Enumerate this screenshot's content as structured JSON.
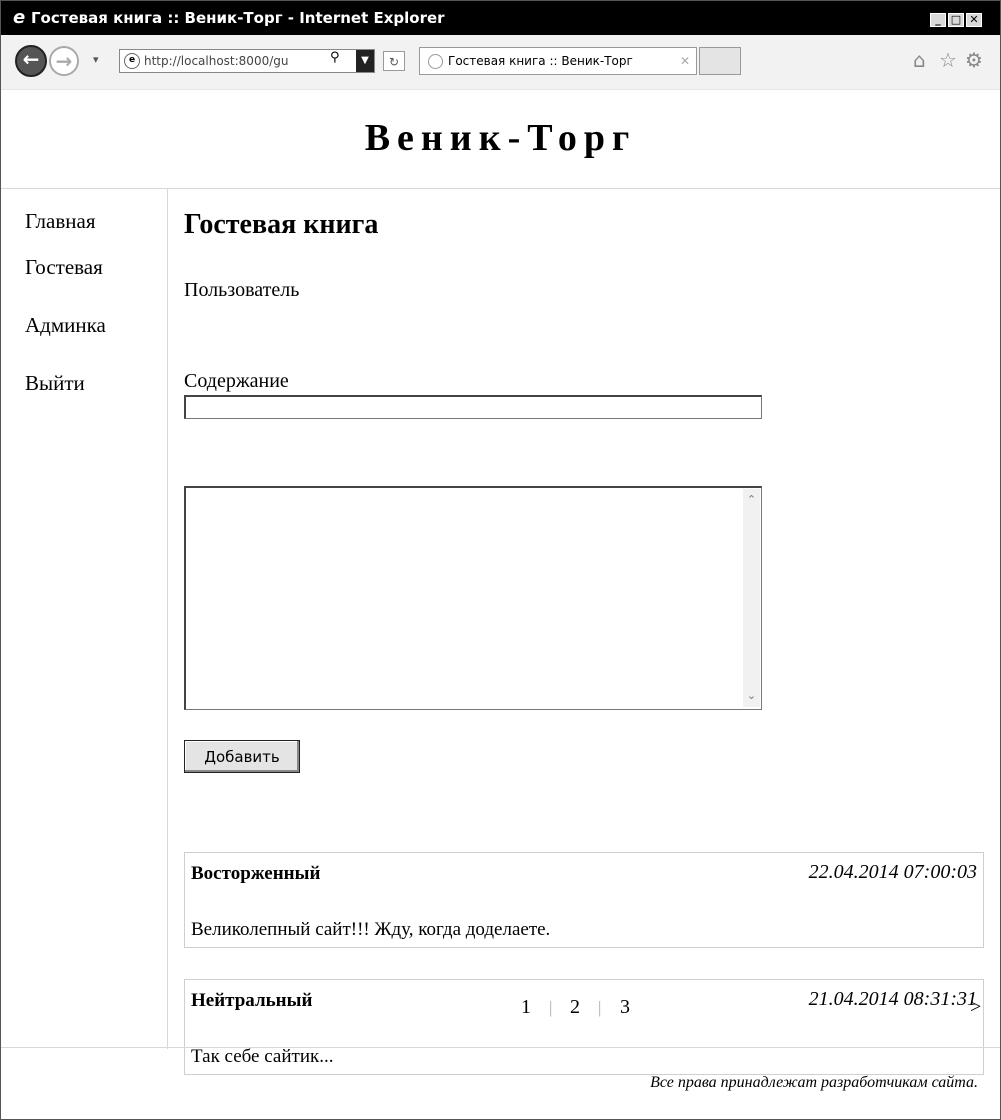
{
  "window": {
    "title": "Гостевая книга :: Веник-Торг - Internet Explorer",
    "controls": [
      "_",
      "□",
      "✕"
    ]
  },
  "browser": {
    "address": "http://localhost:8000/gu",
    "tab_title": "Гостевая книга :: Веник-Торг",
    "icons": [
      "back-icon",
      "forward-icon",
      "ie-page-icon",
      "search-icon",
      "refresh-icon",
      "home-icon",
      "favorites-star-icon",
      "settings-gear-icon"
    ]
  },
  "site": {
    "title": "Веник-Торг",
    "nav": [
      "Главная",
      "Гостевая",
      "Админка",
      "Выйти"
    ]
  },
  "form": {
    "heading": "Гостевая книга",
    "user_label": "Пользователь",
    "user_value": "",
    "content_label": "Содержание",
    "content_value": "",
    "submit_label": "Добавить"
  },
  "entries": [
    {
      "author": "Восторженный",
      "date": "22.04.2014 07:00:03",
      "text": "Великолепный сайт!!! Жду, когда доделаете."
    },
    {
      "author": "Нейтральный",
      "date": "21.04.2014 08:31:31",
      "text": "Так себе сайтик..."
    }
  ],
  "pagination": {
    "pages": [
      "1",
      "2",
      "3"
    ],
    "next": ">"
  },
  "footer": {
    "text": "Все права принадлежат разработчикам сайта."
  }
}
